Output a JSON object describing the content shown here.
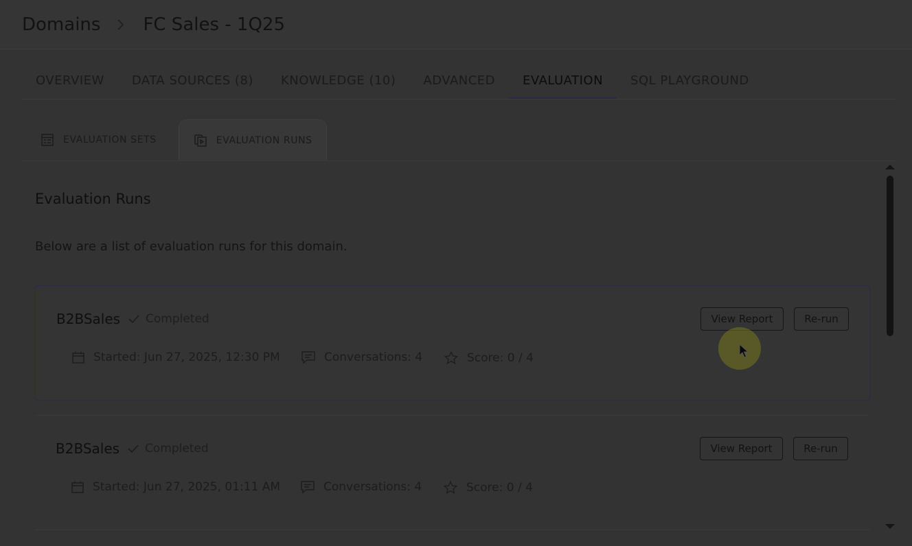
{
  "breadcrumb": {
    "root": "Domains",
    "current": "FC Sales - 1Q25"
  },
  "tabs": [
    {
      "label": "OVERVIEW"
    },
    {
      "label": "DATA SOURCES (8)"
    },
    {
      "label": "KNOWLEDGE (10)"
    },
    {
      "label": "ADVANCED"
    },
    {
      "label": "EVALUATION"
    },
    {
      "label": "SQL PLAYGROUND"
    }
  ],
  "active_tab": "EVALUATION",
  "subtabs": [
    {
      "label": "EVALUATION SETS",
      "icon": "table-icon"
    },
    {
      "label": "EVALUATION RUNS",
      "icon": "copy-run-icon"
    }
  ],
  "active_subtab": "EVALUATION RUNS",
  "main": {
    "title": "Evaluation Runs",
    "description": "Below are a list of evaluation runs for this domain."
  },
  "runs": [
    {
      "name": "B2BSales",
      "status": "Completed",
      "started": "Started: Jun 27, 2025, 12:30 PM",
      "conversations": "Conversations: 4",
      "score": "Score: 0 / 4",
      "view_label": "View Report",
      "rerun_label": "Re-run"
    },
    {
      "name": "B2BSales",
      "status": "Completed",
      "started": "Started: Jun 27, 2025, 01:11 AM",
      "conversations": "Conversations: 4",
      "score": "Score: 0 / 4",
      "view_label": "View Report",
      "rerun_label": "Re-run"
    }
  ],
  "colors": {
    "background": "#333333",
    "accent": "#2a2752",
    "text": "#121212"
  }
}
